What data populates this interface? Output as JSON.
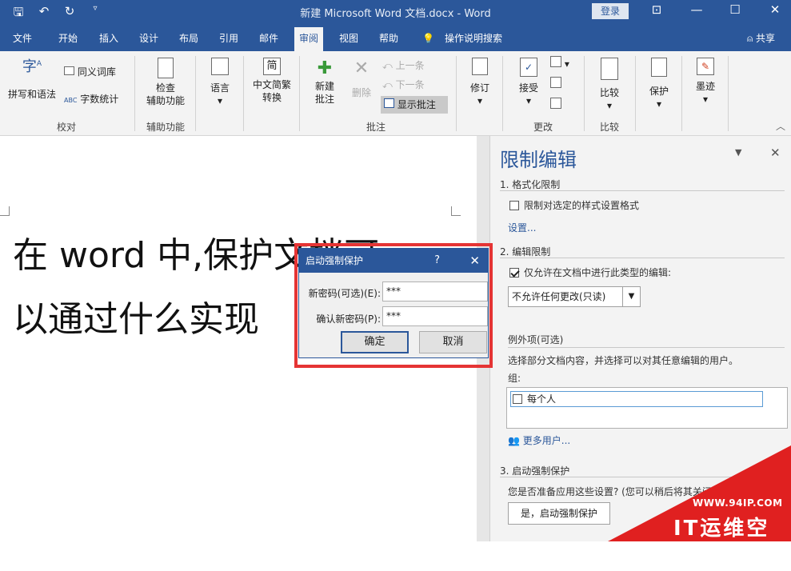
{
  "titlebar": {
    "doc_title": "新建 Microsoft Word 文档.docx - Word",
    "login_label": "登录",
    "qat": {
      "save": "🖫",
      "undo": "↶",
      "redo": "↻"
    }
  },
  "menu": {
    "tabs": [
      "文件",
      "开始",
      "插入",
      "设计",
      "布局",
      "引用",
      "邮件",
      "审阅",
      "视图",
      "帮助",
      "操作说明搜索"
    ],
    "active_tab": "审阅",
    "share_label": "共享"
  },
  "ribbon": {
    "spelling": "拼写和语法",
    "thesaurus": "同义词库",
    "word_count": "字数统计",
    "group_proofing": "校对",
    "check_access_1": "检查",
    "check_access_2": "辅助功能",
    "group_access": "辅助功能",
    "language": "语言",
    "convert_1": "中文简繁",
    "convert_2": "转换",
    "new_comment_1": "新建",
    "new_comment_2": "批注",
    "delete_comment": "删除",
    "prev_comment": "上一条",
    "next_comment": "下一条",
    "show_comments": "显示批注",
    "group_comments": "批注",
    "track": "修订",
    "accept": "接受",
    "group_changes": "更改",
    "compare_btn": "比较",
    "group_compare": "比较",
    "protect": "保护",
    "ink": "墨迹"
  },
  "document": {
    "line1": "在 word 中,保护文档可",
    "line2": "以通过什么实现"
  },
  "pane": {
    "title": "限制编辑",
    "section1": "1. 格式化限制",
    "format_restrict": "限制对选定的样式设置格式",
    "settings_link": "设置...",
    "section2": "2. 编辑限制",
    "edit_restrict": "仅允许在文档中进行此类型的编辑:",
    "edit_type": "不允许任何更改(只读)",
    "exceptions": "例外项(可选)",
    "exceptions_desc": "选择部分文档内容，并选择可以对其任意编辑的用户。",
    "groups_label": "组:",
    "everyone": "每个人",
    "more_users": "更多用户...",
    "section3": "3. 启动强制保护",
    "enforce_desc": "您是否准备应用这些设置? (您可以稍后将其关闭)",
    "enforce_btn": "是，启动强制保护"
  },
  "dialog": {
    "title": "启动强制保护",
    "help": "?",
    "new_password_label": "新密码(可选)(E):",
    "new_password_value": "***",
    "confirm_label": "确认新密码(P):",
    "confirm_value": "***",
    "ok": "确定",
    "cancel": "取消"
  },
  "watermark": {
    "url": "WWW.94IP.COM",
    "brand": "IT运维空间"
  },
  "colors": {
    "accent": "#2b579a",
    "highlight": "#e53434"
  }
}
